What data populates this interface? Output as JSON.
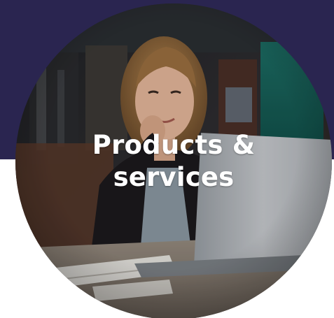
{
  "colors": {
    "top_band": "#2a2550",
    "background": "#ffffff",
    "caption": "#ffffff"
  },
  "card": {
    "title_line_1": "Products &",
    "title_line_2": "services",
    "image_subject": "woman-using-laptop-photo"
  }
}
